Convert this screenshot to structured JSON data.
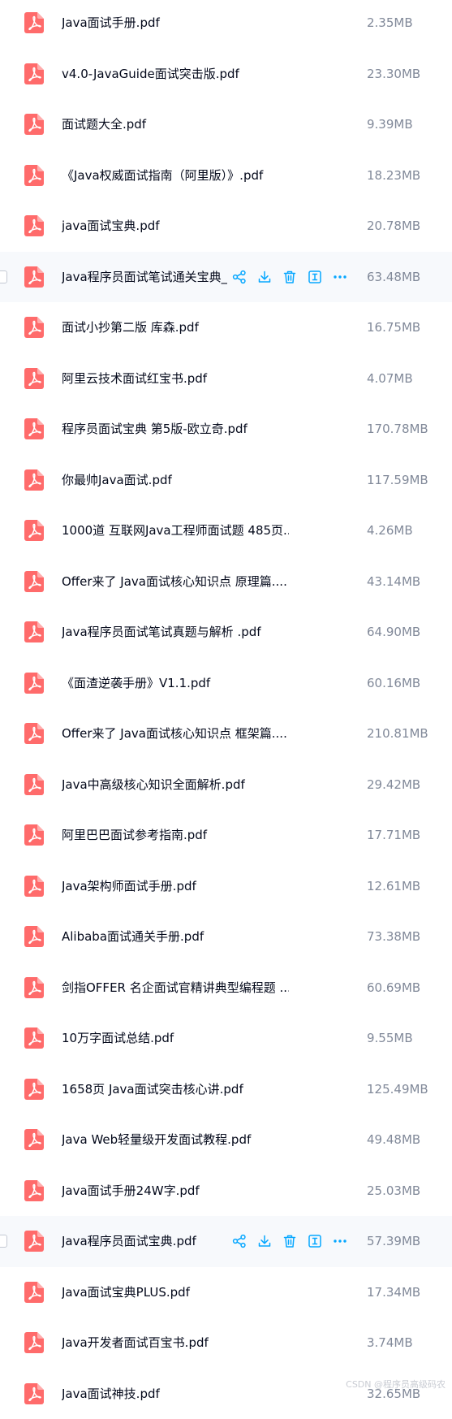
{
  "colors": {
    "pdf_icon": "#ff6b6b",
    "action_icon": "#06a7ff",
    "file_name": "#03081a",
    "file_size": "#818999",
    "hover_row": "#f7f9fc"
  },
  "icons": {
    "file": "pdf-file-icon",
    "actions": [
      "share-icon",
      "download-icon",
      "delete-icon",
      "rename-icon",
      "more-icon"
    ]
  },
  "files": [
    {
      "name": "Java面试手册.pdf",
      "size": "2.35MB"
    },
    {
      "name": "v4.0-JavaGuide面试突击版.pdf",
      "size": "23.30MB"
    },
    {
      "name": "面试题大全.pdf",
      "size": "9.39MB"
    },
    {
      "name": "《Java权威面试指南（阿里版）》.pdf",
      "size": "18.23MB"
    },
    {
      "name": "java面试宝典.pdf",
      "size": "20.78MB"
    },
    {
      "name": "Java程序员面试笔试通关宝典_",
      "size": "63.48MB",
      "hover": true
    },
    {
      "name": "面试小抄第二版 库森.pdf",
      "size": "16.75MB"
    },
    {
      "name": "阿里云技术面试红宝书.pdf",
      "size": "4.07MB"
    },
    {
      "name": "程序员面试宝典 第5版-欧立奇.pdf",
      "size": "170.78MB"
    },
    {
      "name": "你最帅Java面试.pdf",
      "size": "117.59MB"
    },
    {
      "name": "1000道 互联网Java工程师面试题 485页...",
      "size": "4.26MB"
    },
    {
      "name": "Offer来了 Java面试核心知识点 原理篇....",
      "size": "43.14MB"
    },
    {
      "name": "Java程序员面试笔试真题与解析 .pdf",
      "size": "64.90MB"
    },
    {
      "name": "《面渣逆袭手册》V1.1.pdf",
      "size": "60.16MB"
    },
    {
      "name": "Offer来了 Java面试核心知识点 框架篇....",
      "size": "210.81MB"
    },
    {
      "name": "Java中高级核心知识全面解析.pdf",
      "size": "29.42MB"
    },
    {
      "name": "阿里巴巴面试参考指南.pdf",
      "size": "17.71MB"
    },
    {
      "name": "Java架构师面试手册.pdf",
      "size": "12.61MB"
    },
    {
      "name": "Alibaba面试通关手册.pdf",
      "size": "73.38MB"
    },
    {
      "name": "剑指OFFER 名企面试官精讲典型编程题 ...",
      "size": "60.69MB"
    },
    {
      "name": "10万字面试总结.pdf",
      "size": "9.55MB"
    },
    {
      "name": "1658页 Java面试突击核心讲.pdf",
      "size": "125.49MB"
    },
    {
      "name": "Java Web轻量级开发面试教程.pdf",
      "size": "49.48MB"
    },
    {
      "name": "Java面试手册24W字.pdf",
      "size": "25.03MB"
    },
    {
      "name": "Java程序员面试宝典.pdf",
      "size": "57.39MB",
      "hover": true
    },
    {
      "name": "Java面试宝典PLUS.pdf",
      "size": "17.34MB"
    },
    {
      "name": "Java开发者面试百宝书.pdf",
      "size": "3.74MB"
    },
    {
      "name": "Java面试神技.pdf",
      "size": "32.65MB"
    }
  ],
  "watermark": "CSDN @程序员高级码农"
}
